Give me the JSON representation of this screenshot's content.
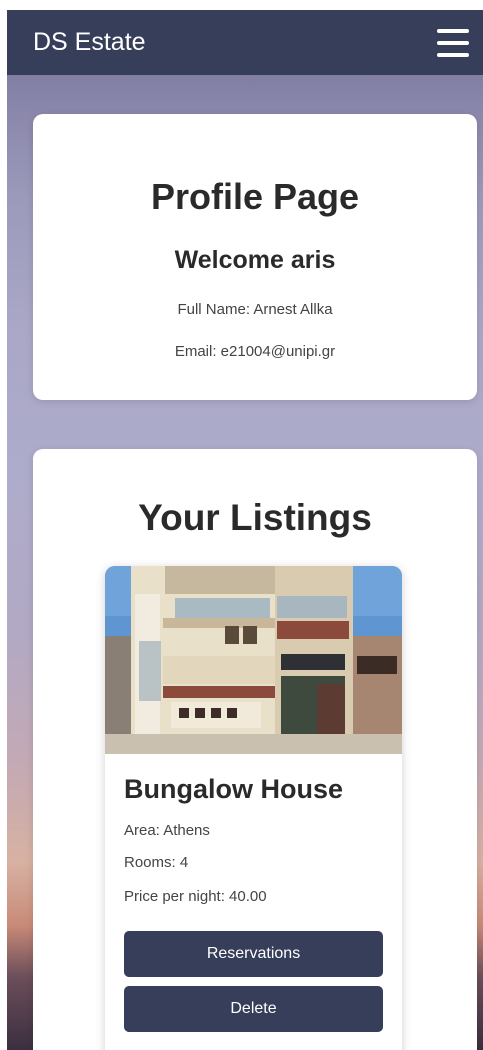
{
  "navbar": {
    "brand": "DS Estate",
    "menu_icon": "hamburger-menu-icon"
  },
  "profile": {
    "title": "Profile Page",
    "welcome": "Welcome aris",
    "full_name": "Full Name: Arnest Allka",
    "email": "Email: e21004@unipi.gr"
  },
  "listings": {
    "title": "Your Listings",
    "items": [
      {
        "name": "Bungalow House",
        "area": "Area: Athens",
        "rooms": "Rooms: 4",
        "price": "Price per night: 40.00",
        "reservations_label": "Reservations",
        "delete_label": "Delete"
      }
    ]
  },
  "colors": {
    "primary": "#363e59",
    "card": "#ffffff",
    "text": "#2a2a2a"
  }
}
